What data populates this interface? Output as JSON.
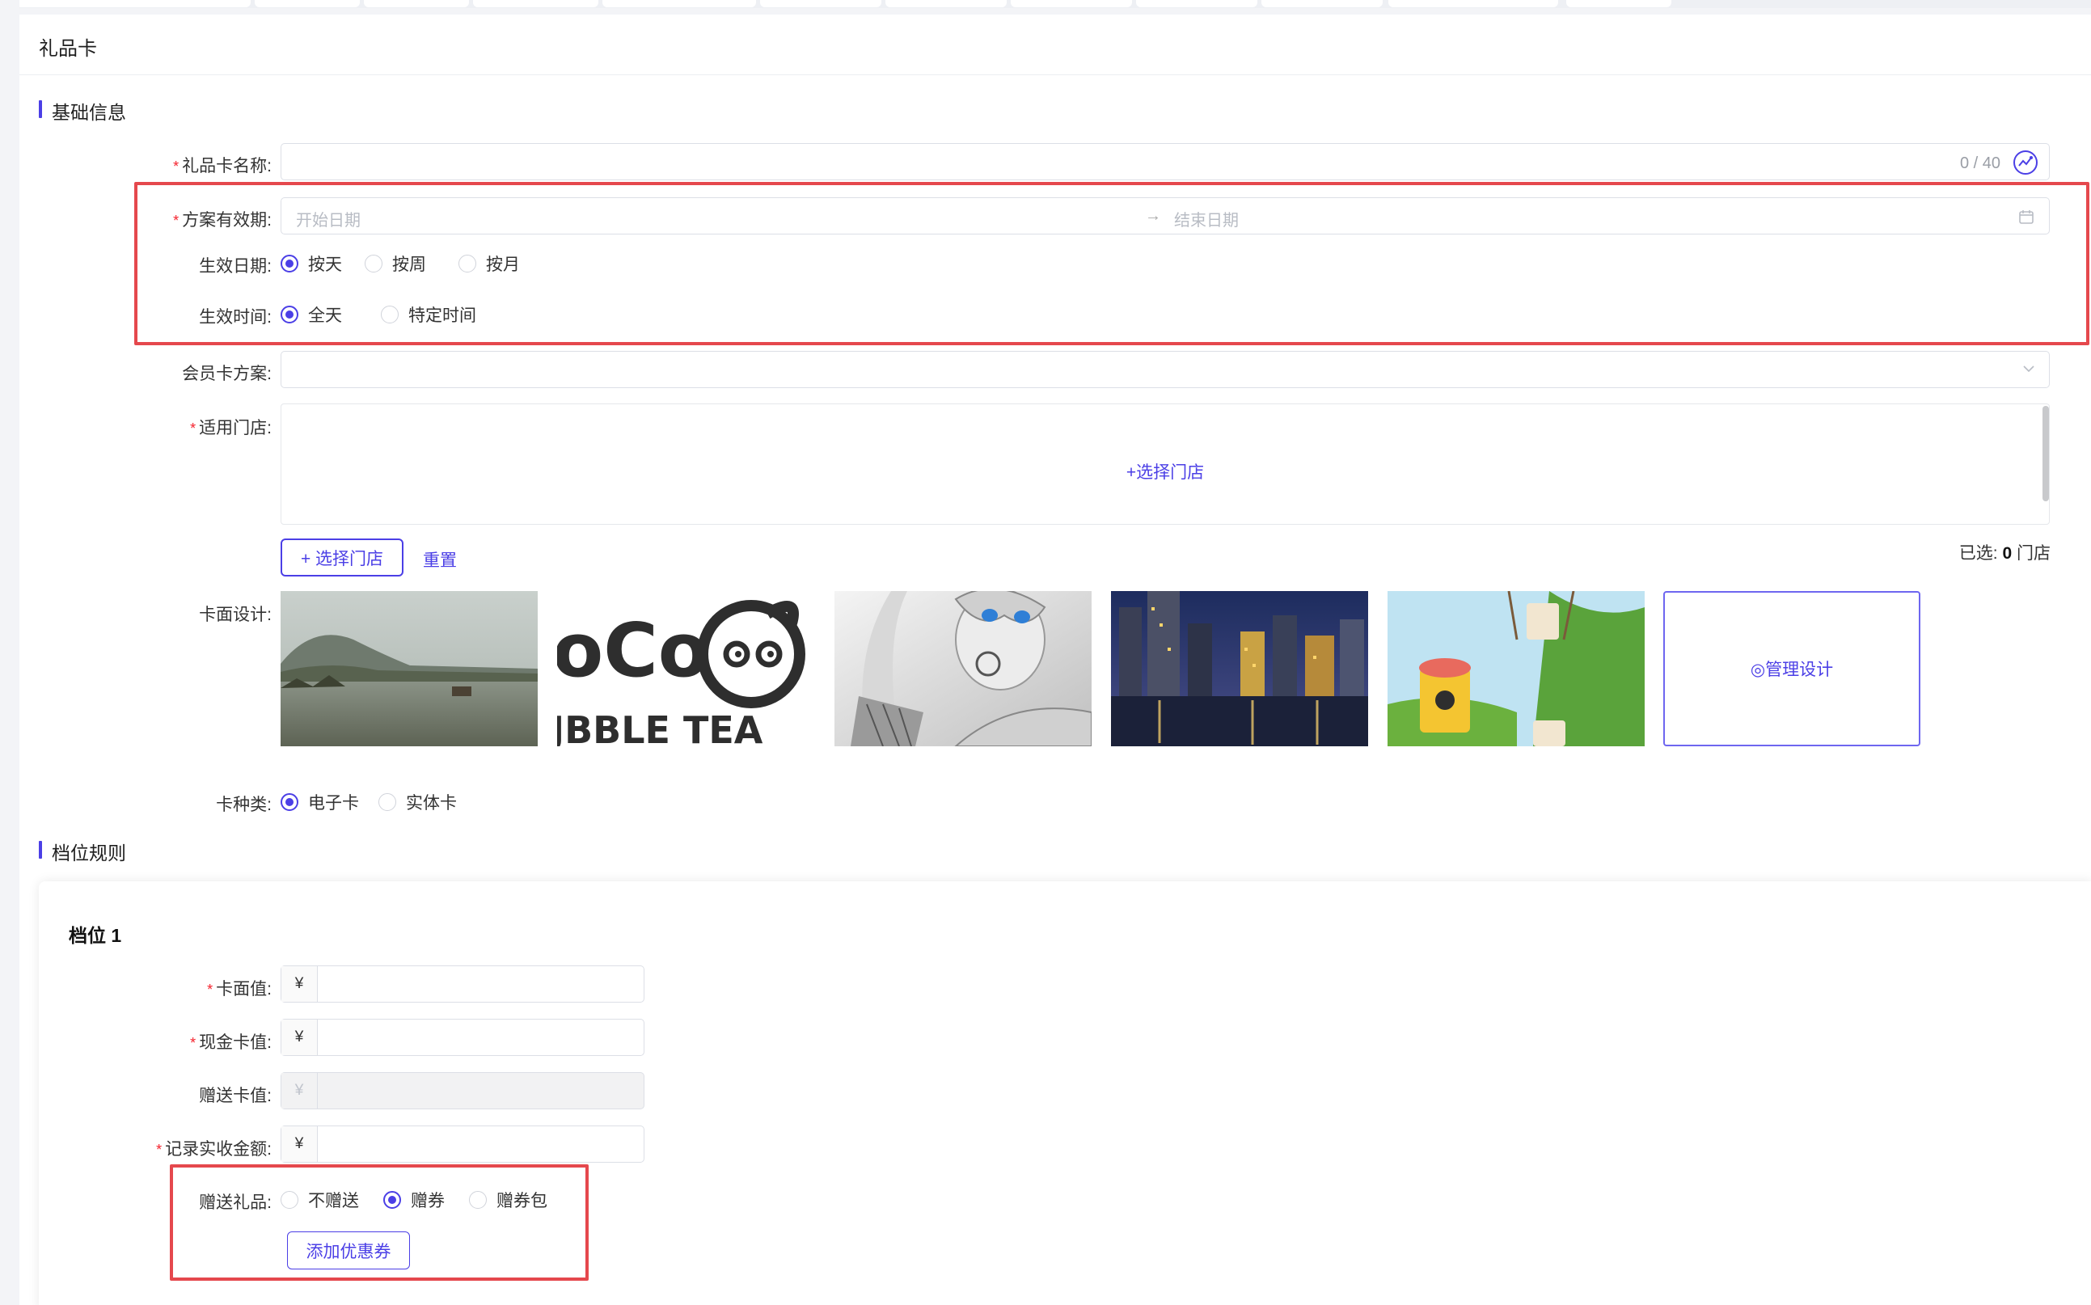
{
  "page": {
    "title": "礼品卡"
  },
  "basic": {
    "section_title": "基础信息",
    "name": {
      "label": "礼品卡名称",
      "value": "",
      "counter": "0 / 40"
    },
    "period": {
      "label": "方案有效期",
      "start_placeholder": "开始日期",
      "end_placeholder": "结束日期",
      "separator": "→"
    },
    "effective_date": {
      "label": "生效日期",
      "options": [
        "按天",
        "按周",
        "按月"
      ],
      "selected": "按天"
    },
    "effective_time": {
      "label": "生效时间",
      "options": [
        "全天",
        "特定时间"
      ],
      "selected": "全天"
    },
    "member_plan": {
      "label": "会员卡方案",
      "value": ""
    },
    "stores": {
      "label": "适用门店",
      "empty_link": "+选择门店",
      "select_button": "+ 选择门店",
      "reset": "重置",
      "selected_prefix": "已选: ",
      "selected_count": "0",
      "selected_suffix": " 门店"
    },
    "card_design": {
      "label": "卡面设计",
      "manage": "◎管理设计",
      "logo_text_top": "oCo",
      "logo_text_bottom": "JBBLE TEA"
    },
    "card_type": {
      "label": "卡种类",
      "options": [
        "电子卡",
        "实体卡"
      ],
      "selected": "电子卡"
    }
  },
  "tiers": {
    "section_title": "档位规则",
    "tier": {
      "title": "档位 1",
      "face_value": {
        "label": "卡面值",
        "prefix": "¥",
        "value": ""
      },
      "cash_value": {
        "label": "现金卡值",
        "prefix": "¥",
        "value": ""
      },
      "gift_value": {
        "label": "赠送卡值",
        "prefix": "¥",
        "value": ""
      },
      "received": {
        "label": "记录实收金额",
        "prefix": "¥",
        "value": ""
      },
      "gift": {
        "label": "赠送礼品",
        "options": [
          "不赠送",
          "赠券",
          "赠券包"
        ],
        "selected": "赠券"
      },
      "add_coupon": "添加优惠券"
    }
  },
  "colors": {
    "primary": "#4b3fe6",
    "highlight": "#e5484d",
    "required": "#f5222d"
  }
}
